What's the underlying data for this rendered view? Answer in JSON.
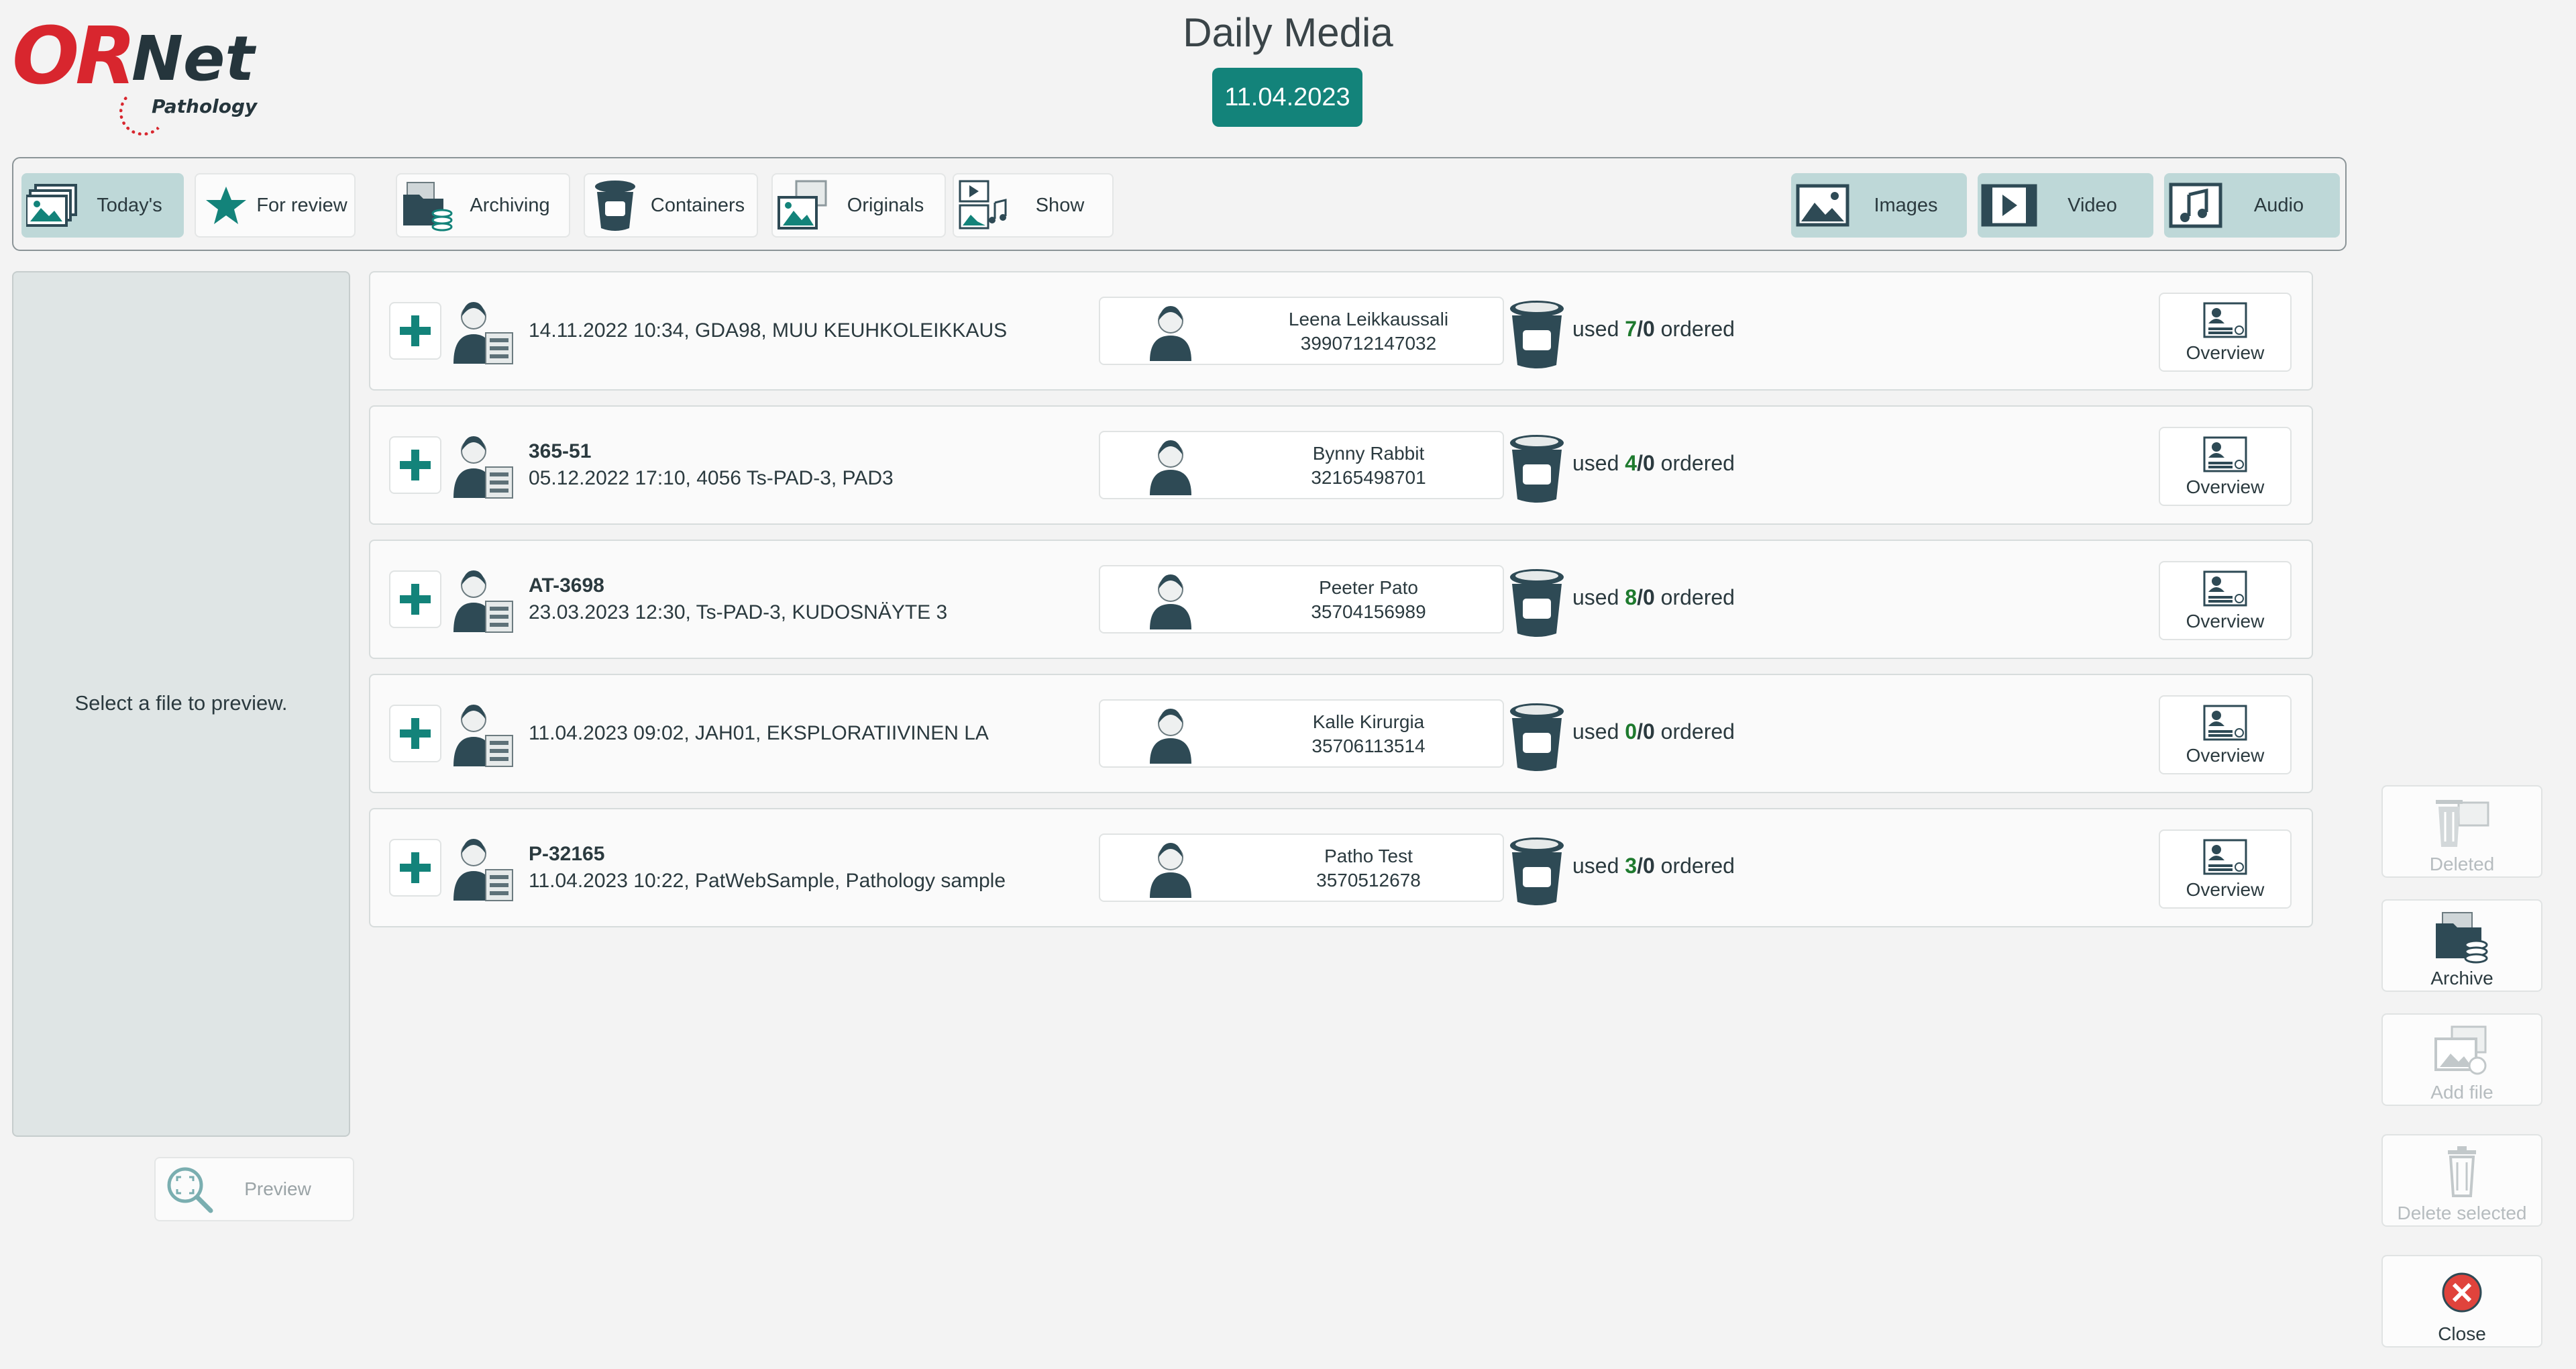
{
  "app": {
    "logo_text_main": "ORNet",
    "logo_text_sub": "Pathology"
  },
  "header": {
    "title": "Daily Media",
    "date": "11.04.2023"
  },
  "toolbar": {
    "todays": "Today's",
    "for_review": "For review",
    "archiving": "Archiving",
    "containers": "Containers",
    "originals": "Originals",
    "show": "Show",
    "images": "Images",
    "video": "Video",
    "audio": "Audio"
  },
  "preview": {
    "message": "Select a file to preview.",
    "button": "Preview"
  },
  "rows": [
    {
      "case_id": "",
      "details": "14.11.2022 10:34, GDA98, MUU KEUHKOLEIKKAUS",
      "patient_name": "Leena Leikkaussali",
      "patient_id": "3990712147032",
      "used": "7",
      "ordered": "0",
      "overview": "Overview"
    },
    {
      "case_id": "365-51",
      "details": "05.12.2022 17:10, 4056 Ts-PAD-3, PAD3",
      "patient_name": "Bynny Rabbit",
      "patient_id": "32165498701",
      "used": "4",
      "ordered": "0",
      "overview": "Overview"
    },
    {
      "case_id": "AT-3698",
      "details": "23.03.2023 12:30, Ts-PAD-3, KUDOSNÄYTE 3",
      "patient_name": "Peeter Pato",
      "patient_id": "35704156989",
      "used": "8",
      "ordered": "0",
      "overview": "Overview"
    },
    {
      "case_id": "",
      "details": "11.04.2023 09:02, JAH01, EKSPLORATIIVINEN LA",
      "patient_name": "Kalle Kirurgia",
      "patient_id": "35706113514",
      "used": "0",
      "ordered": "0",
      "overview": "Overview"
    },
    {
      "case_id": "P-32165",
      "details": "11.04.2023 10:22, PatWebSample, Pathology sample",
      "patient_name": "Patho Test",
      "patient_id": "3570512678",
      "used": "3",
      "ordered": "0",
      "overview": "Overview"
    }
  ],
  "labels": {
    "used": "used",
    "slash": "/",
    "ordered": "ordered"
  },
  "side": {
    "deleted": "Deleted",
    "archive": "Archive",
    "add_file": "Add file",
    "delete_selected": "Delete selected",
    "close": "Close"
  },
  "colors": {
    "accent": "#13837a",
    "active_tab": "#bed8d8",
    "used_count": "#1e7a2e",
    "logo_red": "#d8262e",
    "close_red": "#e0433c"
  }
}
